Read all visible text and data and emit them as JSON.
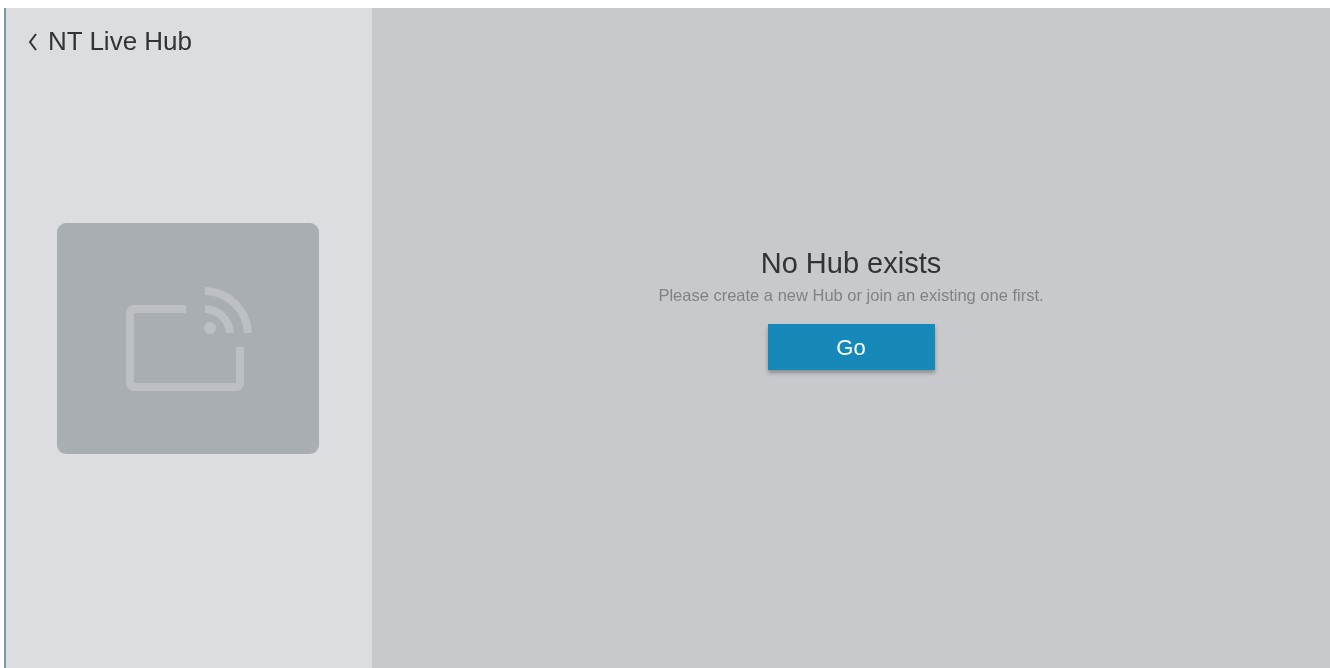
{
  "header": {
    "title": "NT Live Hub"
  },
  "empty_state": {
    "heading": "No Hub exists",
    "message": "Please create a new Hub or join an existing one first.",
    "button": "Go"
  }
}
